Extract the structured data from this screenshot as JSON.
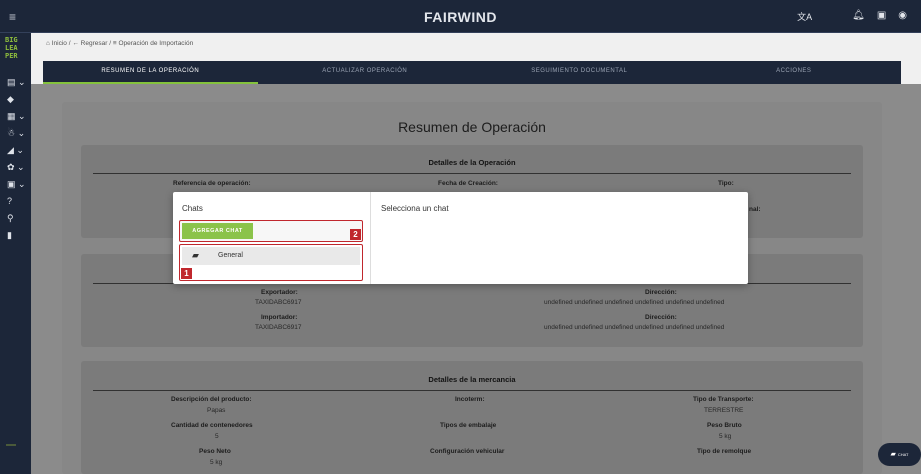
{
  "header": {
    "brand": "FAIRWIND"
  },
  "sidebar": {
    "logo_lines": [
      "BIG",
      "LEA",
      "PER"
    ]
  },
  "breadcrumb": {
    "home": "Inicio",
    "back": "Regresar",
    "current": "Operación de Importación"
  },
  "tabs": [
    "RESUMEN DE LA OPERACIÓN",
    "ACTUALIZAR OPERACIÓN",
    "SEGUIMIENTO DOCUMENTAL",
    "ACCIONES"
  ],
  "background": {
    "title": "Resumen de Operación",
    "details": {
      "heading": "Detalles de la Operación",
      "ref_label": "Referencia de operación:",
      "date_label": "Fecha de Creación:",
      "type_label": "Tipo:",
      "nal_label": "nal:"
    },
    "parties": {
      "exporter_label": "Exportador:",
      "exporter_value": "TAXIDABC6917",
      "importer_label": "Importador:",
      "importer_value": "TAXIDABC6917",
      "address_label": "Dirección:",
      "address_value": "undefined undefined undefined undefined undefined undefined"
    },
    "goods": {
      "heading": "Detalles de la mercancia",
      "rows": [
        [
          {
            "label": "Descripción del producto:",
            "value": "Papas"
          },
          {
            "label": "Incoterm:",
            "value": ""
          },
          {
            "label": "Tipo de Transporte:",
            "value": "TERRESTRE"
          }
        ],
        [
          {
            "label": "Cantidad de contenedores",
            "value": "5"
          },
          {
            "label": "Tipos de embalaje",
            "value": ""
          },
          {
            "label": "Peso Bruto",
            "value": "5 kg"
          }
        ],
        [
          {
            "label": "Peso Neto",
            "value": "5 kg"
          },
          {
            "label": "Configuración vehicular",
            "value": ""
          },
          {
            "label": "Tipo de remolque",
            "value": ""
          }
        ]
      ]
    }
  },
  "modal": {
    "chats_title": "Chats",
    "add_chat_label": "AGREGAR CHAT",
    "chat_items": [
      "General"
    ],
    "select_prompt": "Selecciona un chat",
    "badge_add": "2",
    "badge_list": "1"
  },
  "fab": {
    "label": "CHAT"
  },
  "colors": {
    "navy": "#1c2639",
    "accent_green": "#8bc34a",
    "highlight_red": "#c0272d"
  }
}
